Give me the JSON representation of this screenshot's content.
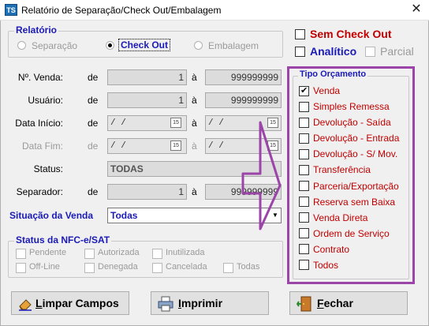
{
  "window": {
    "title": "Relatório de Separação/Check Out/Embalagem",
    "app_icon": "TS",
    "close": "✕"
  },
  "relatorio": {
    "legend": "Relatório",
    "options": [
      {
        "label": "Separação",
        "selected": false,
        "enabled": false
      },
      {
        "label": "Check Out",
        "selected": true,
        "enabled": true
      },
      {
        "label": "Embalagem",
        "selected": false,
        "enabled": false
      }
    ]
  },
  "right_options": {
    "sem_check_out": "Sem Check Out",
    "analitico": "Analítico",
    "parcial": "Parcial"
  },
  "filters": {
    "nvenda": {
      "label": "Nº. Venda:",
      "de": "de",
      "a": "à",
      "from": "1",
      "to": "999999999"
    },
    "usuario": {
      "label": "Usuário:",
      "de": "de",
      "a": "à",
      "from": "1",
      "to": "999999999"
    },
    "data_inicio": {
      "label": "Data Início:",
      "de": "de",
      "a": "à",
      "from": "/ /",
      "to": "/ /"
    },
    "data_fim": {
      "label": "Data Fim:",
      "de": "de",
      "a": "à",
      "from": "/ /",
      "to": "/ /"
    },
    "status": {
      "label": "Status:",
      "value": "TODAS"
    },
    "separador": {
      "label": "Separador:",
      "de": "de",
      "a": "à",
      "from": "1",
      "to": "999999999"
    },
    "situacao": {
      "label": "Situação da Venda",
      "value": "Todas"
    }
  },
  "nfce": {
    "legend": "Status da NFC-e/SAT",
    "items": [
      "Pendente",
      "Autorizada",
      "Inutilizada",
      "Off-Line",
      "Denegada",
      "Cancelada",
      "Todas"
    ]
  },
  "tipo_orcamento": {
    "legend": "Tipo Orçamento",
    "items": [
      {
        "label": "Venda",
        "checked": true
      },
      {
        "label": "Simples Remessa",
        "checked": false
      },
      {
        "label": "Devolução - Saída",
        "checked": false
      },
      {
        "label": "Devolução - Entrada",
        "checked": false
      },
      {
        "label": "Devolução - S/ Mov.",
        "checked": false
      },
      {
        "label": "Transferência",
        "checked": false
      },
      {
        "label": "Parceria/Exportação",
        "checked": false
      },
      {
        "label": "Reserva sem Baixa",
        "checked": false
      },
      {
        "label": "Venda Direta",
        "checked": false
      },
      {
        "label": "Ordem de Serviço",
        "checked": false
      },
      {
        "label": "Contrato",
        "checked": false
      },
      {
        "label": "Todos",
        "checked": false
      }
    ]
  },
  "buttons": {
    "limpar_prefix": "L",
    "limpar_rest": "impar Campos",
    "imprimir_prefix": "I",
    "imprimir_rest": "mprimir",
    "fechar_prefix": "F",
    "fechar_rest": "echar"
  },
  "calendar_glyph": "15",
  "colors": {
    "legend_blue": "#1a1ab8",
    "red_text": "#c00000",
    "highlight_purple": "#9b45a8"
  }
}
